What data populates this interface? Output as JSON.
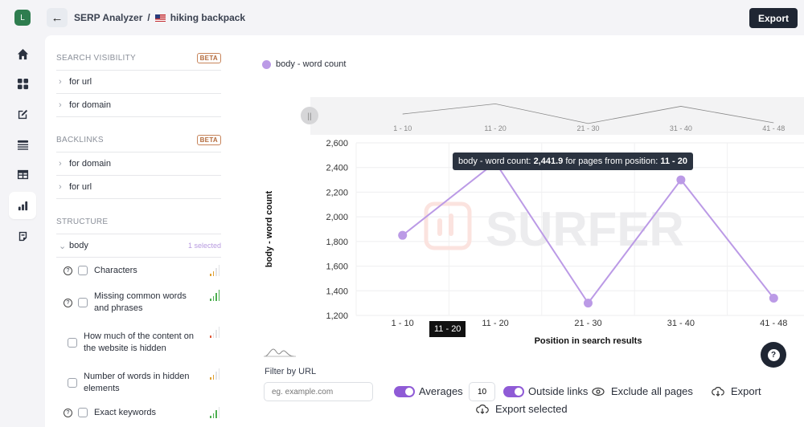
{
  "app": {
    "avatar_letter": "L",
    "breadcrumb": {
      "parent": "SERP Analyzer",
      "separator": "/",
      "current": "hiking backpack",
      "flag": "us-flag-icon"
    },
    "export_label": "Export"
  },
  "rail": {
    "items": [
      {
        "name": "home",
        "icon": "home-icon",
        "active": false
      },
      {
        "name": "dashboard",
        "icon": "grid-icon",
        "active": false
      },
      {
        "name": "editor",
        "icon": "edit-sparkle-icon",
        "active": false
      },
      {
        "name": "list",
        "icon": "list-icon",
        "active": false
      },
      {
        "name": "table",
        "icon": "table-icon",
        "active": false
      },
      {
        "name": "serp-analyzer",
        "icon": "bar-chart-icon",
        "active": true
      },
      {
        "name": "notes",
        "icon": "document-icon",
        "active": false
      }
    ]
  },
  "sidebar": {
    "search_visibility": {
      "title": "SEARCH VISIBILITY",
      "badge": "BETA",
      "items": [
        "for url",
        "for domain"
      ]
    },
    "backlinks": {
      "title": "BACKLINKS",
      "badge": "BETA",
      "items": [
        "for domain",
        "for url"
      ]
    },
    "structure": {
      "title": "STRUCTURE",
      "group": {
        "label": "body",
        "selected_text": "1 selected"
      },
      "metrics": [
        {
          "label": "Characters",
          "has_help": true,
          "checked": false,
          "strength": 2,
          "color": "#e0a030"
        },
        {
          "label": "Missing common words and phrases",
          "has_help": true,
          "checked": false,
          "strength": 4,
          "color": "#4caf50"
        },
        {
          "label": "How much of the content on the website is hidden",
          "has_help": false,
          "checked": false,
          "strength": 1,
          "color": "#e05a3a"
        },
        {
          "label": "Number of words in hidden elements",
          "has_help": false,
          "checked": false,
          "strength": 2,
          "color": "#e0a030"
        },
        {
          "label": "Exact keywords",
          "has_help": true,
          "checked": false,
          "strength": 3,
          "color": "#4caf50"
        }
      ]
    }
  },
  "chart": {
    "tooltip": {
      "prefix": "body - word count:",
      "value": "2,441.9",
      "middle": "for pages from position:",
      "position": "11 - 20"
    },
    "x_hover_label": "11 - 20",
    "watermark": "SURFER"
  },
  "chart_data": {
    "type": "line",
    "title": "",
    "legend": [
      "body - word count"
    ],
    "legend_placement": "top-left",
    "categories": [
      "1 - 10",
      "11 - 20",
      "21 - 30",
      "31 - 40",
      "41 - 48"
    ],
    "series": [
      {
        "name": "body - word count",
        "color": "#bb9ae6",
        "values": [
          1850,
          2441.9,
          1300,
          2300,
          1340
        ]
      }
    ],
    "xlabel": "Position in search results",
    "ylabel": "body - word count",
    "ylim": [
      1200,
      2600
    ],
    "yticks": [
      1200,
      1400,
      1600,
      1800,
      2000,
      2200,
      2400,
      2600
    ],
    "ytick_labels": [
      "1,200",
      "1,400",
      "1,600",
      "1,800",
      "2,000",
      "2,200",
      "2,400",
      "2,600"
    ],
    "grid": true,
    "navigator": {
      "categories": [
        "1 - 10",
        "11 - 20",
        "21 - 30",
        "31 - 40",
        "41 - 48"
      ]
    }
  },
  "controls": {
    "filter_label": "Filter by URL",
    "filter_placeholder": "eg. example.com",
    "averages_label": "Averages",
    "averages_on": true,
    "averages_value": "10",
    "outside_links_label": "Outside links",
    "outside_links_on": true,
    "exclude_label": "Exclude all pages",
    "export_label": "Export",
    "export_selected_label": "Export selected",
    "help_label": "?"
  }
}
